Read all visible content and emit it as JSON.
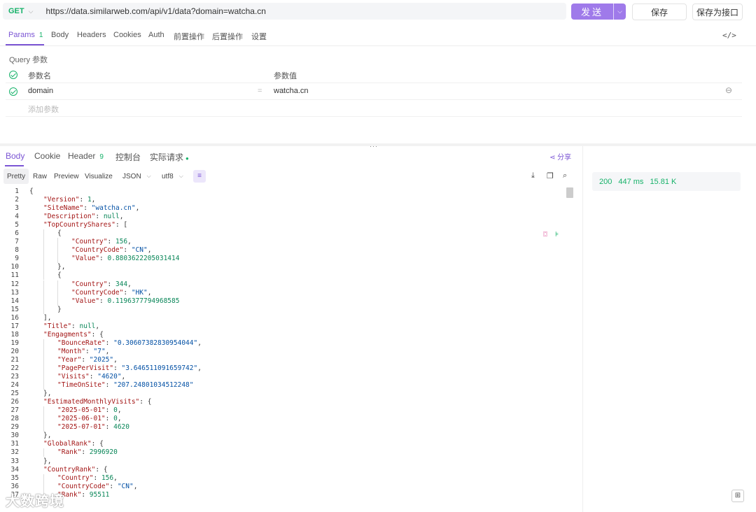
{
  "request": {
    "method": "GET",
    "url": "https://data.similarweb.com/api/v1/data?domain=watcha.cn",
    "send_label": "发送",
    "save_label": "保存",
    "save_as_label": "保存为接口"
  },
  "request_tabs": [
    {
      "label": "Params",
      "count": "1"
    },
    {
      "label": "Body"
    },
    {
      "label": "Headers"
    },
    {
      "label": "Cookies"
    },
    {
      "label": "Auth"
    },
    {
      "label": "前置操作"
    },
    {
      "label": "后置操作"
    },
    {
      "label": "设置"
    }
  ],
  "code_icon": "</>",
  "query": {
    "section_label": "Query 参数",
    "name_header": "参数名",
    "value_header": "参数值",
    "rows": [
      {
        "name": "domain",
        "value": "watcha.cn"
      }
    ],
    "add_placeholder": "添加参数"
  },
  "response_tabs": [
    {
      "label": "Body"
    },
    {
      "label": "Cookie"
    },
    {
      "label": "Header",
      "count": "9"
    },
    {
      "label": "控制台"
    },
    {
      "label": "实际请求"
    }
  ],
  "share_label": "分享",
  "formats": [
    "Pretty",
    "Raw",
    "Preview",
    "Visualize"
  ],
  "format_select": "JSON",
  "encoding_select": "utf8",
  "status": {
    "code": "200",
    "time": "447 ms",
    "size": "15.81 K"
  },
  "watermark": "大数跨境",
  "code_lines": [
    "{",
    "    \"Version\": 1,",
    "    \"SiteName\": \"watcha.cn\",",
    "    \"Description\": null,",
    "    \"TopCountryShares\": [",
    "        {",
    "            \"Country\": 156,",
    "            \"CountryCode\": \"CN\",",
    "            \"Value\": 0.8803622205031414",
    "        },",
    "        {",
    "            \"Country\": 344,",
    "            \"CountryCode\": \"HK\",",
    "            \"Value\": 0.1196377794968585",
    "        }",
    "    ],",
    "    \"Title\": null,",
    "    \"Engagments\": {",
    "        \"BounceRate\": \"0.30607382830954044\",",
    "        \"Month\": \"7\",",
    "        \"Year\": \"2025\",",
    "        \"PagePerVisit\": \"3.646511091659742\",",
    "        \"Visits\": \"4620\",",
    "        \"TimeOnSite\": \"207.24801034512248\"",
    "    },",
    "    \"EstimatedMonthlyVisits\": {",
    "        \"2025-05-01\": 0,",
    "        \"2025-06-01\": 0,",
    "        \"2025-07-01\": 4620",
    "    },",
    "    \"GlobalRank\": {",
    "        \"Rank\": 2996920",
    "    },",
    "    \"CountryRank\": {",
    "        \"Country\": 156,",
    "        \"CountryCode\": \"CN\",",
    "        \"Rank\": 95511"
  ]
}
